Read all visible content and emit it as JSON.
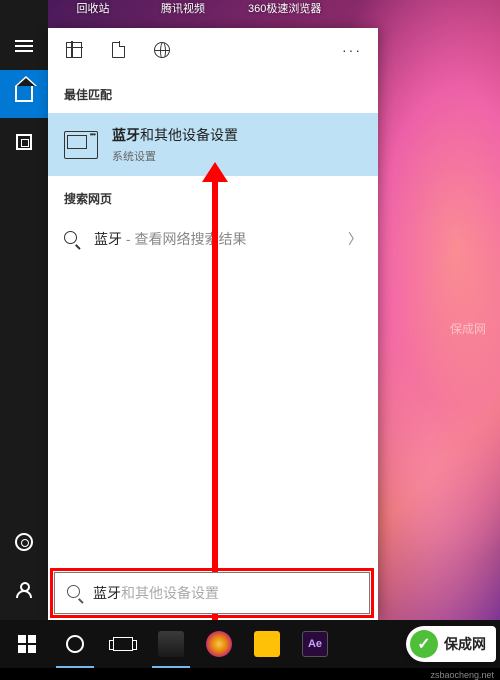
{
  "desktop": {
    "icons": [
      "回收站",
      "腾讯视频",
      "360极速浏览器"
    ]
  },
  "rail": {
    "menu": "菜单",
    "home": "主页",
    "pinned": "固定",
    "settings": "设置",
    "user": "用户"
  },
  "toolbar": {
    "all": "全部",
    "documents": "文档",
    "web": "网页",
    "more": "···"
  },
  "sections": {
    "best_match": "最佳匹配",
    "search_web": "搜索网页"
  },
  "best_match": {
    "title_bold": "蓝牙",
    "title_rest": "和其他设备设置",
    "subtitle": "系统设置"
  },
  "web_result": {
    "label_bold": "蓝牙",
    "label_rest": " - 查看网络搜索结果",
    "chevron": "〉"
  },
  "search": {
    "typed": "蓝牙",
    "ghost": "和其他设备设置"
  },
  "taskbar": {
    "start": "开始",
    "cortana": "Cortana",
    "taskview": "任务视图",
    "apps": [
      "文件管理器",
      "浏览器",
      "文件夹",
      "Ae"
    ]
  },
  "watermark": {
    "brand": "保成网",
    "url": "zsbaocheng.net",
    "mid": "保成网"
  }
}
